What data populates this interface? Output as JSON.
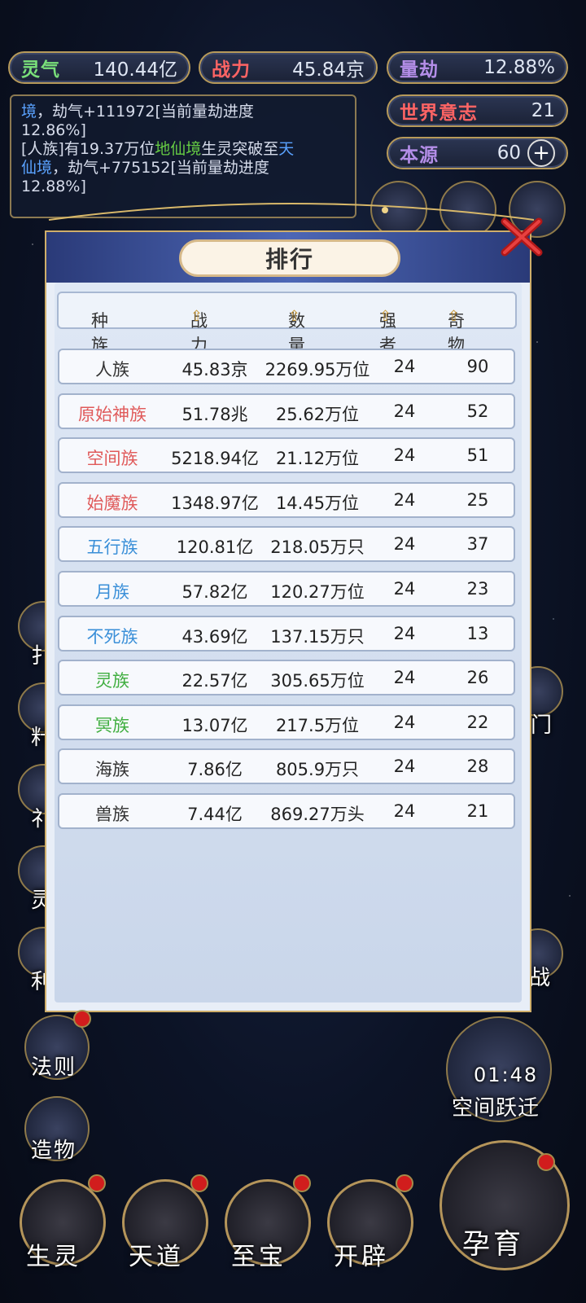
{
  "stats": {
    "lingqi": {
      "label": "灵气",
      "value": "140.44亿"
    },
    "zhanli": {
      "label": "战力",
      "value": "45.84京"
    },
    "liangjie": {
      "label": "量劫",
      "value": "12.88%"
    },
    "shijie": {
      "label": "世界意志",
      "value": "21"
    },
    "benyuan": {
      "label": "本源",
      "value": "60"
    }
  },
  "log": {
    "line1_prefix": "境",
    "line1_rest": "，劫气+111972[当前量劫进度",
    "line2": "12.86%]",
    "line3_a": "[人族]有19.37万位",
    "line3_realm": "地仙境",
    "line3_b": "生灵突破至",
    "line3_realm2a": "天",
    "line4_realm2b": "仙境",
    "line4_rest": "，劫气+775152[当前量劫进度",
    "line5": "12.88%]"
  },
  "panel": {
    "title": "排行"
  },
  "table": {
    "headers": [
      "种族",
      "战力",
      "数量",
      "强者",
      "奇物"
    ],
    "rows": [
      {
        "name": "人族",
        "power": "45.83京",
        "count": "2269.95万位",
        "strong": "24",
        "items": "90",
        "color": "#333333"
      },
      {
        "name": "原始神族",
        "power": "51.78兆",
        "count": "25.62万位",
        "strong": "24",
        "items": "52",
        "color": "#e05a5a"
      },
      {
        "name": "空间族",
        "power": "5218.94亿",
        "count": "21.12万位",
        "strong": "24",
        "items": "51",
        "color": "#e05a5a"
      },
      {
        "name": "始魔族",
        "power": "1348.97亿",
        "count": "14.45万位",
        "strong": "24",
        "items": "25",
        "color": "#e05a5a"
      },
      {
        "name": "五行族",
        "power": "120.81亿",
        "count": "218.05万只",
        "strong": "24",
        "items": "37",
        "color": "#3a8fd8"
      },
      {
        "name": "月族",
        "power": "57.82亿",
        "count": "120.27万位",
        "strong": "24",
        "items": "23",
        "color": "#3a8fd8"
      },
      {
        "name": "不死族",
        "power": "43.69亿",
        "count": "137.15万只",
        "strong": "24",
        "items": "13",
        "color": "#3a8fd8"
      },
      {
        "name": "灵族",
        "power": "22.57亿",
        "count": "305.65万位",
        "strong": "24",
        "items": "26",
        "color": "#3fae3f"
      },
      {
        "name": "冥族",
        "power": "13.07亿",
        "count": "217.5万位",
        "strong": "24",
        "items": "22",
        "color": "#3fae3f"
      },
      {
        "name": "海族",
        "power": "7.86亿",
        "count": "805.9万只",
        "strong": "24",
        "items": "28",
        "color": "#333333"
      },
      {
        "name": "兽族",
        "power": "7.44亿",
        "count": "869.27万头",
        "strong": "24",
        "items": "21",
        "color": "#333333"
      }
    ]
  },
  "side": {
    "left_partial": [
      "扌",
      "籵",
      "礻",
      "灵",
      "利"
    ],
    "right_partial": [
      "门",
      "战"
    ],
    "fagze": "法则",
    "zaowu": "造物",
    "timer": "01:48",
    "kongjian": "空间跃迁"
  },
  "nav": {
    "items": [
      "生灵",
      "天道",
      "至宝",
      "开辟",
      "孕育"
    ]
  },
  "colors": {
    "accent_gold": "#cfae6a",
    "panel_bg": "#e8eef7",
    "header_blue": "#3a4f9a"
  }
}
